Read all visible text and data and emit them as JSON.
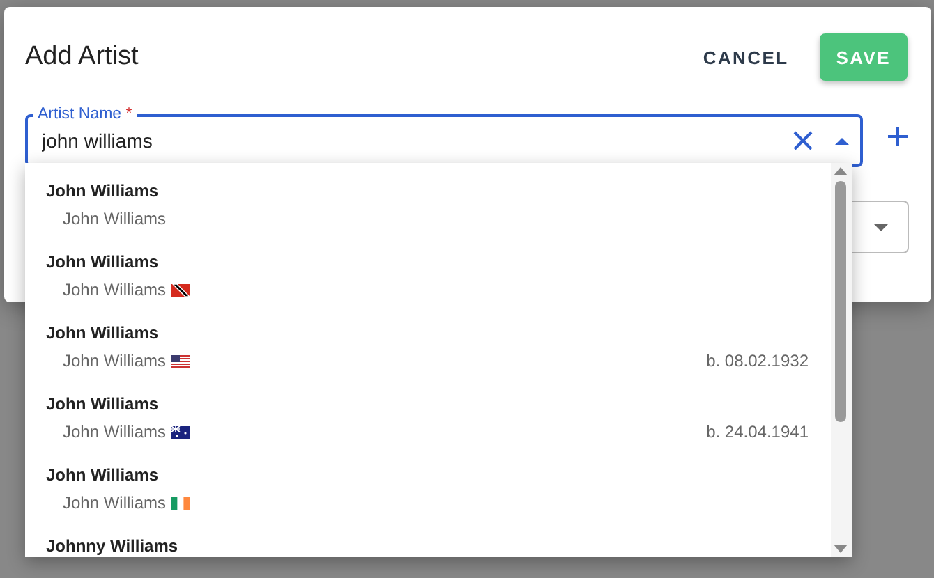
{
  "dialog": {
    "title": "Add Artist",
    "buttons": [
      {
        "kind": "text",
        "label": "CANCEL"
      },
      {
        "kind": "primary",
        "label": "SAVE"
      }
    ]
  },
  "artist_field": {
    "label": "Artist Name",
    "required_mark": "*",
    "value": "john williams",
    "focused": true
  },
  "options": [
    {
      "title": "John Williams",
      "subtitle": "John Williams"
    },
    {
      "title": "John Williams",
      "subtitle": "John Williams",
      "kind": "tt"
    },
    {
      "title": "John Williams",
      "subtitle": "John Williams",
      "kind": "us",
      "date": "b. 08.02.1932"
    },
    {
      "title": "John Williams",
      "subtitle": "John Williams",
      "kind": "au",
      "date": "b. 24.04.1941"
    },
    {
      "title": "John Williams",
      "subtitle": "John Williams",
      "kind": "ie"
    },
    {
      "title": "Johnny Williams"
    }
  ]
}
